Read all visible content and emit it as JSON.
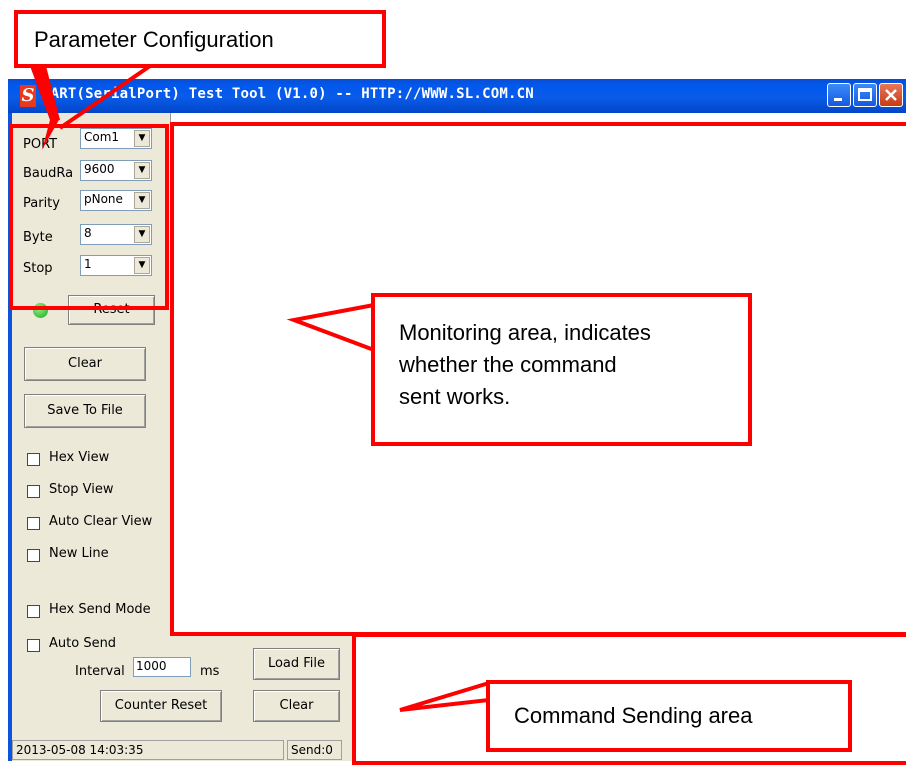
{
  "window": {
    "title": "UART(SerialPort) Test Tool (V1.0) -- HTTP://WWW.SL.COM.CN",
    "logo_glyph": "S"
  },
  "params": {
    "port": {
      "label": "PORT",
      "value": "Com1"
    },
    "baud": {
      "label": "BaudRa",
      "value": "9600"
    },
    "parity": {
      "label": "Parity",
      "value": "pNone"
    },
    "byte": {
      "label": "Byte",
      "value": "8"
    },
    "stop": {
      "label": "Stop",
      "value": "1"
    }
  },
  "buttons": {
    "reset": "Reset",
    "clear": "Clear",
    "save_to_file": "Save To File",
    "load_file": "Load File",
    "clear_send": "Clear",
    "counter_reset": "Counter Reset"
  },
  "checkboxes": {
    "hex_view": "Hex View",
    "stop_view": "Stop View",
    "auto_clear_view": "Auto Clear View",
    "new_line": "New Line",
    "hex_send_mode": "Hex Send Mode",
    "auto_send": "Auto Send"
  },
  "interval": {
    "label": "Interval",
    "value": "1000",
    "unit": "ms"
  },
  "status": {
    "datetime": "2013-05-08 14:03:35",
    "send": "Send:0"
  },
  "annotations": {
    "param_config": "Parameter Configuration",
    "monitoring": [
      "Monitoring area, indicates",
      "whether the command",
      "sent works."
    ],
    "command_sending": "Command Sending area"
  },
  "colors": {
    "annotation_red": "#ff0000",
    "titlebar_blue": "#0058ee",
    "led_green": "#1ba71b"
  }
}
